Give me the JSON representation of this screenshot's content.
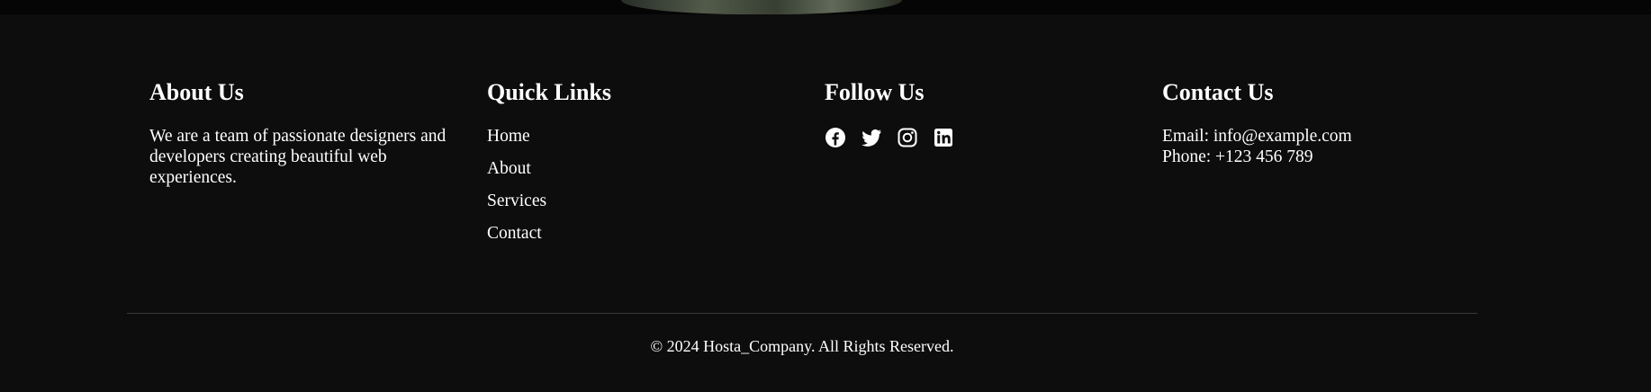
{
  "footer": {
    "about": {
      "title": "About Us",
      "text": "We are a team of passionate designers and developers creating beautiful web experiences."
    },
    "quick_links": {
      "title": "Quick Links",
      "items": [
        {
          "label": "Home"
        },
        {
          "label": "About"
        },
        {
          "label": "Services"
        },
        {
          "label": "Contact"
        }
      ]
    },
    "follow": {
      "title": "Follow Us",
      "icons": [
        "facebook-icon",
        "twitter-icon",
        "instagram-icon",
        "linkedin-icon"
      ]
    },
    "contact": {
      "title": "Contact Us",
      "email_line": "Email: info@example.com",
      "phone_line": "Phone: +123 456 789"
    },
    "copyright": "© 2024 Hosta_Company. All Rights Reserved."
  },
  "colors": {
    "background": "#0d0d0d",
    "text": "#ffffff",
    "divider": "#3a3a3a"
  }
}
